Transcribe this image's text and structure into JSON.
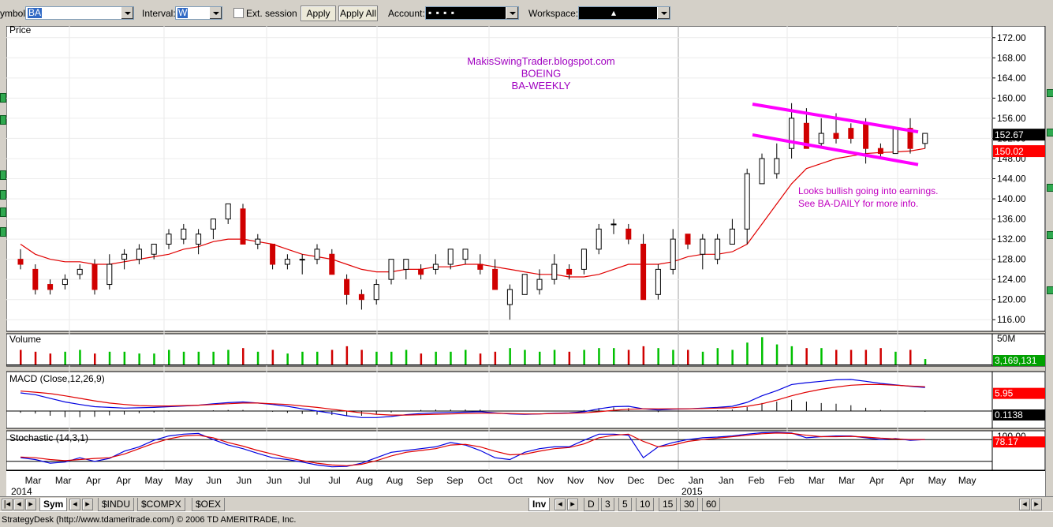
{
  "toolbar": {
    "symbol_label": "Symbol:",
    "symbol_value": "BA",
    "interval_label": "Interval:",
    "interval_value": "W",
    "ext_session_label": "Ext. session",
    "apply_label": "Apply",
    "apply_all_label": "Apply All",
    "account_label": "Account:",
    "account_value": "▪   ▪   ▪   ▪",
    "workspace_label": "Workspace:",
    "workspace_value": "▴"
  },
  "chart_data": [
    {
      "type": "candlestick",
      "panel": "Price",
      "title": "Price",
      "annotations": [
        "MakisSwingTrader.blogspot.com",
        "BOEING",
        "BA-WEEKLY"
      ],
      "note": [
        "Looks bullish going into earnings.",
        "See BA-DAILY for more info."
      ],
      "ylim": [
        114,
        174
      ],
      "yticks": [
        "172.00",
        "168.00",
        "164.00",
        "160.00",
        "156.00",
        "152.00",
        "148.00",
        "144.00",
        "140.00",
        "136.00",
        "132.00",
        "128.00",
        "124.00",
        "120.00",
        "116.00"
      ],
      "last_price": "152.67",
      "ma_price": "150.02",
      "xticks": [
        "Mar",
        "Mar",
        "Apr",
        "Apr",
        "May",
        "May",
        "Jun",
        "Jun",
        "Jun",
        "Jul",
        "Jul",
        "Aug",
        "Aug",
        "Sep",
        "Sep",
        "Oct",
        "Oct",
        "Nov",
        "Nov",
        "Nov",
        "Dec",
        "Dec",
        "Jan",
        "Jan",
        "Feb",
        "Feb",
        "Mar",
        "Mar",
        "Apr",
        "Apr",
        "May",
        "May"
      ],
      "year_labels": [
        "2014",
        "2015"
      ],
      "candles": [
        [
          128,
          130,
          126,
          127
        ],
        [
          126,
          127,
          121,
          122
        ],
        [
          123,
          124,
          121,
          122
        ],
        [
          123,
          125,
          122,
          124
        ],
        [
          125,
          127,
          124,
          126
        ],
        [
          127,
          128,
          121,
          122
        ],
        [
          123,
          129,
          122,
          127
        ],
        [
          128,
          130,
          126,
          129
        ],
        [
          128,
          131,
          127,
          130
        ],
        [
          129,
          131,
          128,
          131
        ],
        [
          131,
          134,
          130,
          133
        ],
        [
          132,
          135,
          131,
          134
        ],
        [
          131,
          134,
          129,
          133
        ],
        [
          134,
          136,
          132,
          136
        ],
        [
          136,
          139,
          135,
          139
        ],
        [
          138,
          139,
          131,
          131
        ],
        [
          131,
          133,
          130,
          132
        ],
        [
          131,
          131,
          126,
          127
        ],
        [
          127,
          129,
          126,
          128
        ],
        [
          128,
          129,
          125,
          128
        ],
        [
          128,
          131,
          127,
          130
        ],
        [
          129,
          130,
          125,
          125
        ],
        [
          124,
          125,
          119,
          121
        ],
        [
          121,
          122,
          118,
          120
        ],
        [
          120,
          124,
          119,
          123
        ],
        [
          124,
          128,
          123,
          128
        ],
        [
          126,
          128,
          124,
          128
        ],
        [
          126,
          127,
          124,
          125
        ],
        [
          126,
          129,
          125,
          127
        ],
        [
          127,
          130,
          126,
          130
        ],
        [
          128,
          130,
          127,
          130
        ],
        [
          127,
          129,
          125,
          126
        ],
        [
          126,
          128,
          122,
          122
        ],
        [
          119,
          123,
          116,
          122
        ],
        [
          121,
          125,
          121,
          125
        ],
        [
          122,
          126,
          121,
          124
        ],
        [
          124,
          129,
          123,
          127
        ],
        [
          126,
          127,
          124,
          125
        ],
        [
          126,
          130,
          125,
          130
        ],
        [
          130,
          135,
          129,
          134
        ],
        [
          135,
          136,
          133,
          135
        ],
        [
          134,
          135,
          131,
          132
        ],
        [
          131,
          133,
          120,
          120
        ],
        [
          121,
          127,
          120,
          126
        ],
        [
          126,
          134,
          125,
          132
        ],
        [
          133,
          133,
          130,
          131
        ],
        [
          129,
          133,
          126,
          132
        ],
        [
          128,
          133,
          127,
          132
        ],
        [
          131,
          136,
          131,
          134
        ],
        [
          134,
          146,
          131,
          145
        ],
        [
          143,
          149,
          143,
          148
        ],
        [
          145,
          151,
          144,
          148
        ],
        [
          150,
          159,
          148,
          156
        ],
        [
          155,
          158,
          150,
          150
        ],
        [
          151,
          156,
          150,
          153
        ],
        [
          153,
          157,
          151,
          152
        ],
        [
          154,
          155,
          151,
          152
        ],
        [
          155,
          156,
          147,
          150
        ],
        [
          150,
          151,
          148,
          149
        ],
        [
          149,
          154,
          149,
          154
        ],
        [
          154,
          156,
          149,
          150
        ],
        [
          151,
          153,
          150,
          153
        ]
      ],
      "ma": [
        131,
        129,
        128,
        127.5,
        127.5,
        127,
        127,
        127.5,
        128,
        128.5,
        129,
        130,
        130.5,
        131.5,
        132,
        132,
        131.5,
        131,
        130,
        129,
        128.5,
        128,
        127,
        126,
        125.5,
        125.5,
        126,
        126,
        126.5,
        126.5,
        127,
        127,
        126.5,
        126,
        125.5,
        125,
        125,
        124.5,
        124.5,
        125,
        126,
        127,
        127,
        127,
        127.5,
        128.5,
        129,
        129,
        129.5,
        131,
        135,
        139,
        143,
        146,
        147,
        148,
        148.5,
        149,
        149.2,
        149.3,
        149.5,
        150
      ]
    },
    {
      "type": "bar",
      "panel": "Volume",
      "title": "Volume",
      "scale_label": "50M",
      "last_value": "3,169,131",
      "values": [
        8,
        7,
        6,
        7,
        8,
        6,
        7,
        7,
        6,
        6,
        8,
        7,
        7,
        7,
        8,
        9,
        7,
        8,
        6,
        7,
        7,
        8,
        10,
        8,
        7,
        7,
        8,
        6,
        7,
        7,
        8,
        6,
        7,
        9,
        8,
        7,
        8,
        7,
        8,
        9,
        9,
        8,
        10,
        9,
        8,
        8,
        7,
        9,
        8,
        12,
        15,
        11,
        10,
        9,
        9,
        8,
        8,
        8,
        9,
        7,
        8,
        3
      ]
    },
    {
      "type": "line",
      "panel": "MACD",
      "title": "MACD (Close,12,26,9)",
      "last_value": "5.95",
      "hist_value": "0.1138",
      "series": [
        {
          "name": "MACD",
          "values": [
            5,
            4.5,
            3.5,
            2.5,
            1.8,
            1.2,
            1,
            0.8,
            0.9,
            1,
            1.2,
            1.4,
            1.6,
            2,
            2.3,
            2.5,
            2.2,
            1.8,
            1.3,
            0.6,
            0,
            -0.6,
            -1.3,
            -1.8,
            -1.8,
            -1.5,
            -1,
            -0.7,
            -0.5,
            -0.4,
            -0.3,
            -0.2,
            -0.5,
            -0.8,
            -0.9,
            -0.8,
            -0.6,
            -0.5,
            -0.2,
            0.6,
            1.2,
            1.3,
            0.6,
            0.3,
            0.5,
            0.6,
            0.8,
            1,
            1.3,
            2.4,
            4.2,
            5.6,
            7.3,
            7.8,
            8.2,
            8.6,
            8.7,
            8.2,
            7.6,
            7.2,
            6.8,
            6.5
          ]
        },
        {
          "name": "Signal",
          "values": [
            5.5,
            5.2,
            4.8,
            4.2,
            3.5,
            2.8,
            2.2,
            1.8,
            1.5,
            1.4,
            1.4,
            1.5,
            1.6,
            1.8,
            2,
            2.2,
            2.2,
            2,
            1.8,
            1.4,
            1,
            0.5,
            0,
            -0.5,
            -0.9,
            -1.1,
            -1.1,
            -1,
            -0.9,
            -0.8,
            -0.7,
            -0.6,
            -0.6,
            -0.7,
            -0.8,
            -0.8,
            -0.7,
            -0.6,
            -0.5,
            -0.2,
            0.2,
            0.5,
            0.6,
            0.6,
            0.6,
            0.6,
            0.7,
            0.8,
            0.9,
            1.3,
            2,
            3,
            4.2,
            5.2,
            6,
            6.6,
            7.1,
            7.3,
            7.3,
            7.1,
            6.9,
            6.7
          ]
        },
        {
          "name": "Histogram",
          "values": [
            -0.5,
            -0.7,
            -1.3,
            -1.7,
            -1.7,
            -1.6,
            -1.2,
            -1,
            -0.6,
            -0.4,
            -0.2,
            -0.1,
            0,
            0.2,
            0.3,
            0.3,
            0,
            -0.2,
            -0.5,
            -0.8,
            -1,
            -1.1,
            -1.3,
            -1.3,
            -0.9,
            -0.4,
            0.1,
            0.3,
            0.4,
            0.4,
            0.4,
            0.4,
            0.1,
            -0.1,
            -0.1,
            0,
            0.1,
            0.1,
            0.3,
            0.8,
            1,
            0.8,
            0,
            -0.3,
            -0.1,
            0,
            0.1,
            0.2,
            0.4,
            1.1,
            2.2,
            2.6,
            3.1,
            2.6,
            2.2,
            2,
            1.6,
            0.9,
            0.3,
            0.1,
            -0.1,
            -0.2
          ]
        }
      ]
    },
    {
      "type": "line",
      "panel": "Stochastic",
      "title": "Stochastic (14,3,1)",
      "scale_label": "100.00",
      "last_value": "78.17",
      "series": [
        {
          "name": "%K",
          "values": [
            30,
            25,
            15,
            18,
            30,
            20,
            28,
            48,
            60,
            78,
            90,
            95,
            97,
            80,
            65,
            55,
            42,
            30,
            25,
            18,
            10,
            5,
            6,
            15,
            30,
            45,
            50,
            55,
            60,
            72,
            65,
            50,
            30,
            25,
            45,
            55,
            60,
            60,
            78,
            95,
            95,
            92,
            30,
            60,
            72,
            80,
            85,
            87,
            90,
            95,
            99,
            100,
            98,
            85,
            88,
            90,
            90,
            85,
            80,
            83,
            78,
            80
          ]
        },
        {
          "name": "%D",
          "values": [
            32,
            30,
            25,
            22,
            25,
            28,
            30,
            40,
            55,
            70,
            82,
            90,
            92,
            85,
            72,
            62,
            50,
            40,
            30,
            22,
            15,
            10,
            8,
            12,
            22,
            35,
            45,
            50,
            55,
            65,
            67,
            60,
            48,
            38,
            40,
            48,
            55,
            58,
            68,
            85,
            92,
            95,
            75,
            60,
            65,
            75,
            80,
            84,
            88,
            92,
            96,
            98,
            97,
            92,
            88,
            88,
            89,
            87,
            84,
            82,
            80,
            80
          ]
        }
      ]
    }
  ],
  "bottom": {
    "sym_tab": "Sym",
    "tabs": [
      "$INDU",
      "$COMPX",
      "$OEX"
    ],
    "inv_tab": "Inv",
    "period_tabs": [
      "D",
      "3",
      "5",
      "10",
      "15",
      "30",
      "60"
    ]
  },
  "status": "StrategyDesk (http://www.tdameritrade.com/) © 2006 TD AMERITRADE, Inc.",
  "colors": {
    "up": "#00c000",
    "down": "#d00000",
    "ma": "#e00000",
    "channel": "#ff00ff",
    "blue": "#0000e0",
    "note": "#c000c0",
    "title": "#a000c0"
  }
}
